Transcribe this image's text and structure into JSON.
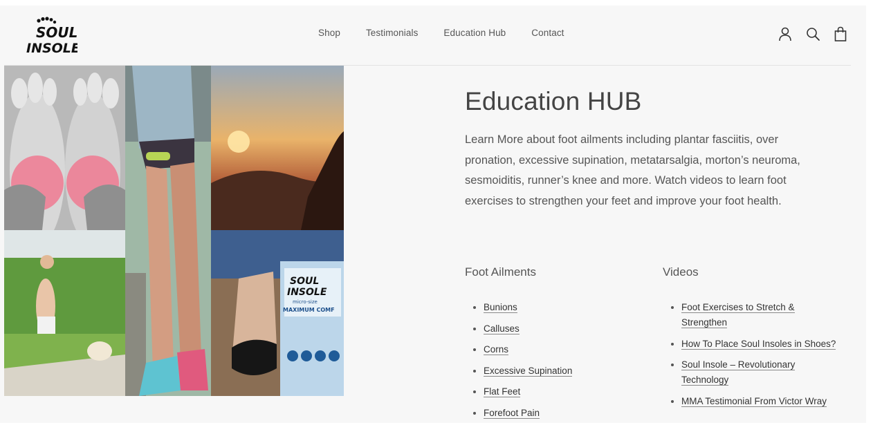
{
  "brand": {
    "logo_line1": "SOUL",
    "logo_line2": "INSOLE"
  },
  "nav": {
    "items": [
      {
        "label": "Shop"
      },
      {
        "label": "Testimonials"
      },
      {
        "label": "Education Hub"
      },
      {
        "label": "Contact"
      }
    ],
    "icons": [
      "account-icon",
      "search-icon",
      "shopping-bag-icon"
    ]
  },
  "collage": {
    "tiles": [
      "foot-pain-highlight-photo",
      "knee-pain-runner-photo",
      "sunset-mountain-photo",
      "woman-running-with-dog-photo",
      "blue-sneakers-photo",
      "soul-insole-package-photo"
    ],
    "package_text_line1": "SOUL",
    "package_text_line2": "INSOLE",
    "package_text_line3": "micro-size",
    "package_text_line4": "MAXIMUM COMF"
  },
  "main": {
    "title": "Education HUB",
    "intro": "Learn More about foot ailments including plantar fasciitis, over pronation, excessive supination, metatarsalgia, morton’s neuroma, sesmoiditis, runner’s knee and more. Watch videos to learn foot exercises to strengthen your feet and improve your foot health.",
    "ailments": {
      "heading": "Foot Ailments",
      "items": [
        "Bunions",
        "Calluses",
        "Corns",
        "Excessive Supination",
        "Flat Feet",
        "Forefoot Pain"
      ]
    },
    "videos": {
      "heading": "Videos",
      "items": [
        "Foot Exercises to Stretch & Strengthen",
        "How To Place Soul Insoles in Shoes?",
        "Soul Insole – Revolutionary Technology",
        "MMA Testimonial From Victor Wray"
      ]
    }
  }
}
